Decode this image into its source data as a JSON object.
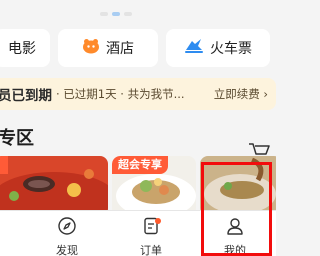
{
  "quick_links": [
    {
      "label": "电影",
      "icon": "movie-icon"
    },
    {
      "label": "酒店",
      "icon": "hotel-icon"
    },
    {
      "label": "火车票",
      "icon": "train-ticket-icon"
    }
  ],
  "member_bar": {
    "title": "员已到期",
    "subtitle": "· 已过期1天 · 共为我节...",
    "renew": "立即续费 ›"
  },
  "section": {
    "title": "专区"
  },
  "cards": [
    {
      "tag": "",
      "image": "food-tomato-soup"
    },
    {
      "tag": "超会专享",
      "image": "food-seafood-plate"
    },
    {
      "tag": "",
      "image": "food-grilled-fish"
    }
  ],
  "tabbar": {
    "items": [
      {
        "label": "发现",
        "icon": "compass-icon"
      },
      {
        "label": "订单",
        "icon": "order-icon",
        "has_badge": true
      },
      {
        "label": "我的",
        "icon": "profile-icon"
      }
    ]
  },
  "colors": {
    "accent": "#ff5b37",
    "member_bg": "#fdf3dd",
    "highlight": "#f20c0c"
  }
}
